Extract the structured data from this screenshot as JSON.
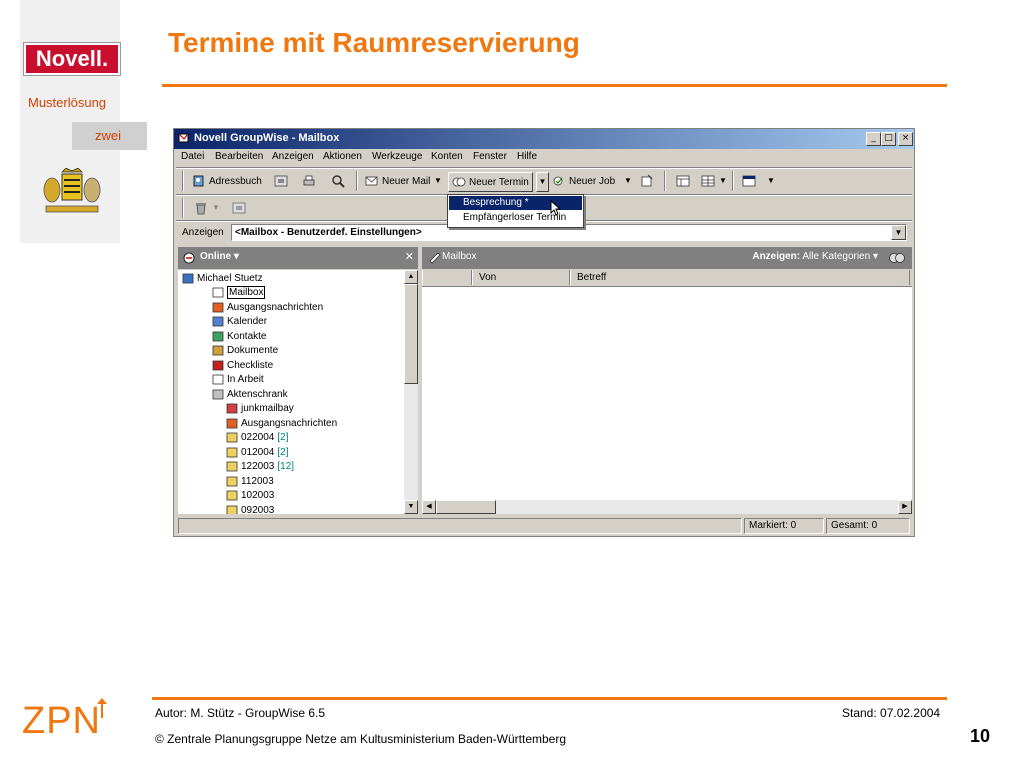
{
  "slide": {
    "title": "Termine mit Raumreservierung",
    "logo_text": "Novell.",
    "sidebar_label": "Musterlösung",
    "sidebar_tag": "zwei",
    "footer_author": "Autor: M. Stütz - GroupWise 6.5",
    "footer_date": "Stand: 07.02.2004",
    "footer_copyright": "©  Zentrale Planungsgruppe Netze am Kultusministerium Baden-Württemberg",
    "page_number": "10",
    "org_logo": "ZPN",
    "accent_color": "#f07810"
  },
  "window": {
    "title": "Novell GroupWise - Mailbox",
    "controls": [
      "_",
      "□",
      "×"
    ],
    "menu": [
      "Datei",
      "Bearbeiten",
      "Anzeigen",
      "Aktionen",
      "Werkzeuge",
      "Konten",
      "Fenster",
      "Hilfe"
    ],
    "toolbar": {
      "address_book": "Adressbuch",
      "new_mail": "Neuer Mail",
      "new_appointment": "Neuer Termin",
      "new_task": "Neuer Job"
    },
    "dropdown": {
      "items": [
        "Besprechung *",
        "Empfängerloser Termin"
      ]
    },
    "view_label": "Anzeigen",
    "view_value": "<Mailbox - Benutzerdef. Einstellungen>",
    "left_pane": {
      "mode": "Online",
      "tree": [
        {
          "label": "Michael Stuetz",
          "count": ""
        },
        {
          "label": "Mailbox",
          "count": ""
        },
        {
          "label": "Ausgangsnachrichten",
          "count": ""
        },
        {
          "label": "Kalender",
          "count": ""
        },
        {
          "label": "Kontakte",
          "count": ""
        },
        {
          "label": "Dokumente",
          "count": ""
        },
        {
          "label": "Checkliste",
          "count": ""
        },
        {
          "label": "In Arbeit",
          "count": ""
        },
        {
          "label": "Aktenschrank",
          "count": ""
        },
        {
          "label": "junkmailbay",
          "count": ""
        },
        {
          "label": "Ausgangsnachrichten",
          "count": ""
        },
        {
          "label": "022004",
          "count": "[2]"
        },
        {
          "label": "012004",
          "count": "[2]"
        },
        {
          "label": "122003",
          "count": "[12]"
        },
        {
          "label": "112003",
          "count": ""
        },
        {
          "label": "102003",
          "count": ""
        },
        {
          "label": "092003",
          "count": ""
        }
      ]
    },
    "right_pane": {
      "title": "Mailbox",
      "filter_label": "Anzeigen:",
      "filter_value": "Alle Kategorien",
      "columns": [
        "Von",
        "Betreff"
      ]
    },
    "status": {
      "marked": "Markiert: 0",
      "total": "Gesamt: 0"
    }
  }
}
